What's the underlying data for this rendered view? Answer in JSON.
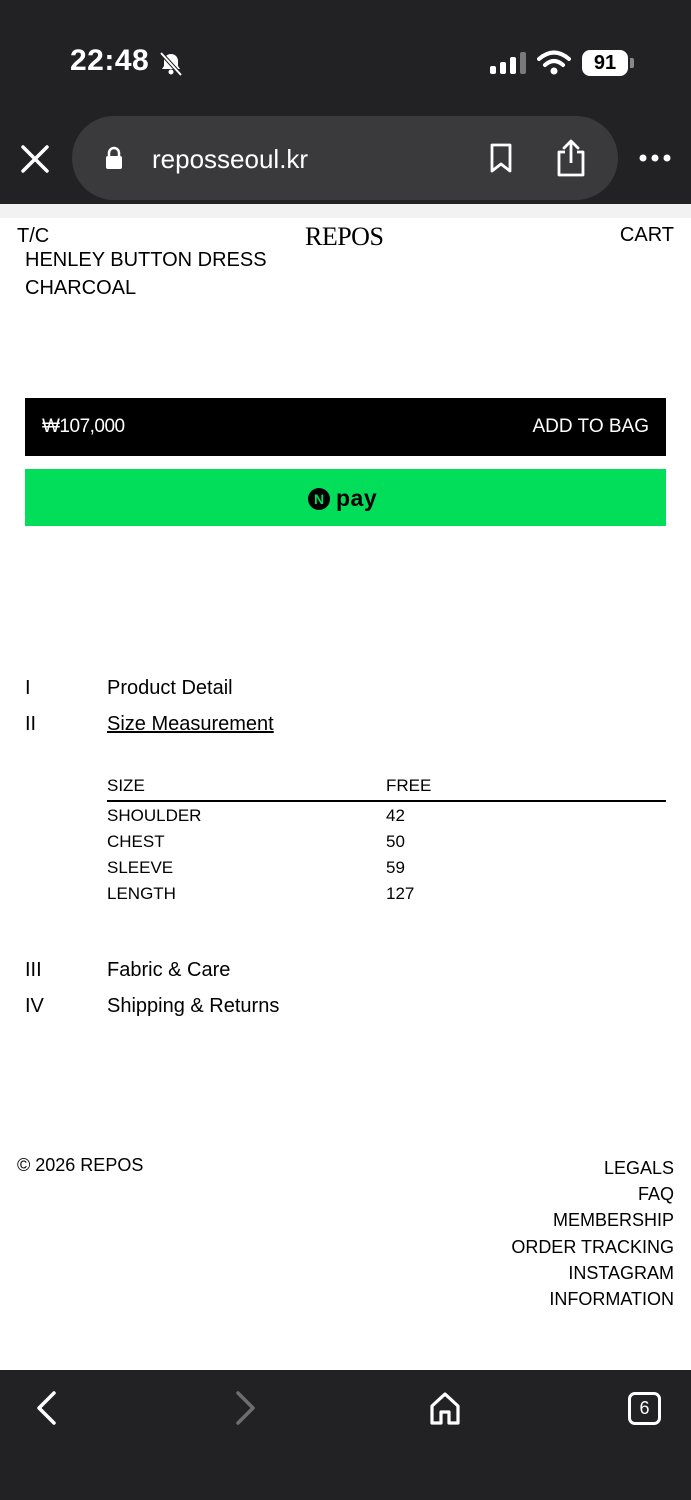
{
  "status_bar": {
    "time": "22:48",
    "battery": "91"
  },
  "browser": {
    "url": "reposseoul.kr"
  },
  "header": {
    "left_label": "T/C",
    "brand": "REPOS",
    "cart_label": "CART"
  },
  "product": {
    "name_line1": "HENLEY BUTTON DRESS",
    "name_line2": "CHARCOAL",
    "price": "₩107,000",
    "add_to_bag": "ADD TO BAG",
    "npay_n": "N",
    "npay_text": "pay"
  },
  "sections": [
    {
      "num": "I",
      "label": "Product Detail"
    },
    {
      "num": "II",
      "label": "Size Measurement"
    },
    {
      "num": "III",
      "label": "Fabric & Care"
    },
    {
      "num": "IV",
      "label": "Shipping & Returns"
    }
  ],
  "size_table": {
    "header": [
      "SIZE",
      "FREE"
    ],
    "rows": [
      [
        "SHOULDER",
        "42"
      ],
      [
        "CHEST",
        "50"
      ],
      [
        "SLEEVE",
        "59"
      ],
      [
        "LENGTH",
        "127"
      ]
    ]
  },
  "footer": {
    "copyright": "© 2026 REPOS",
    "links": [
      "LEGALS",
      "FAQ",
      "MEMBERSHIP",
      "ORDER TRACKING",
      "INSTAGRAM",
      "INFORMATION"
    ]
  },
  "toolbar": {
    "tab_count": "6"
  }
}
